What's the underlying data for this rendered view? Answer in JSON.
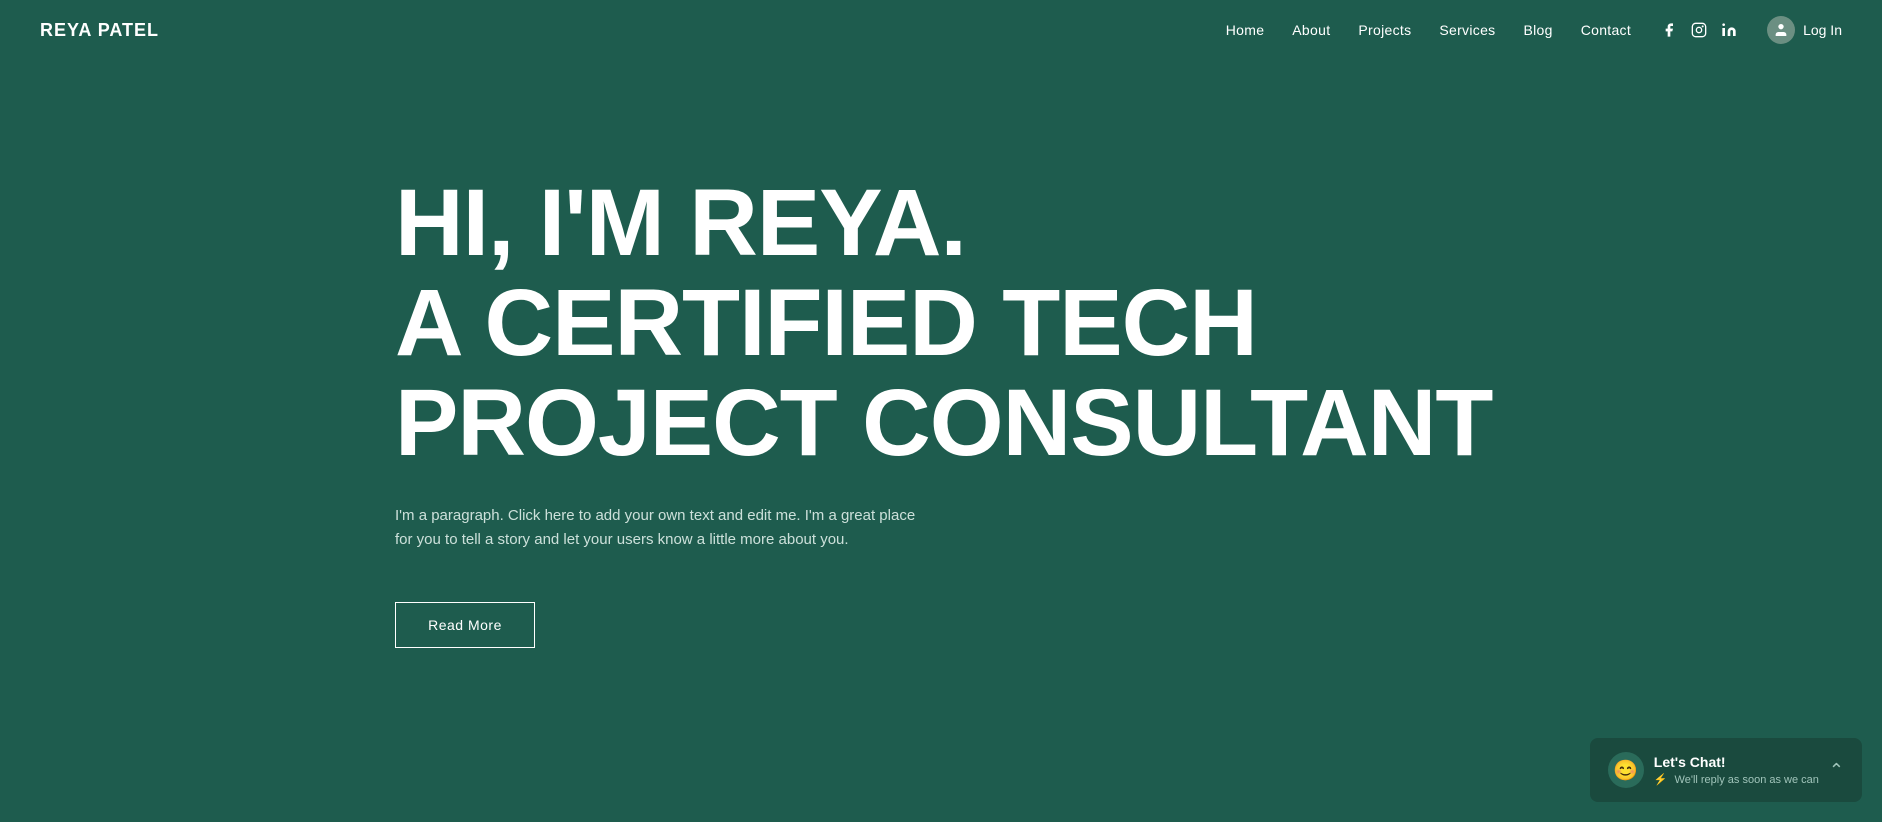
{
  "site": {
    "logo": "REYA PATEL",
    "background_color": "#1e5c4e"
  },
  "navbar": {
    "links": [
      {
        "label": "Home",
        "id": "home"
      },
      {
        "label": "About",
        "id": "about"
      },
      {
        "label": "Projects",
        "id": "projects"
      },
      {
        "label": "Services",
        "id": "services"
      },
      {
        "label": "Blog",
        "id": "blog"
      },
      {
        "label": "Contact",
        "id": "contact"
      }
    ],
    "social": [
      {
        "label": "Facebook",
        "id": "facebook"
      },
      {
        "label": "Instagram",
        "id": "instagram"
      },
      {
        "label": "LinkedIn",
        "id": "linkedin"
      }
    ],
    "login_label": "Log In"
  },
  "hero": {
    "line1": "HI, I'M REYA.",
    "line2": "A CERTIFIED TECH",
    "line3": "PROJECT CONSULTANT",
    "paragraph": "I'm a paragraph. Click here to add your own text and edit me. I'm a great place for you to tell a story and let your users know a little more about you.",
    "cta_label": "Read More"
  },
  "chat": {
    "title": "Let's Chat!",
    "subtitle": "We'll reply as soon as we can"
  }
}
